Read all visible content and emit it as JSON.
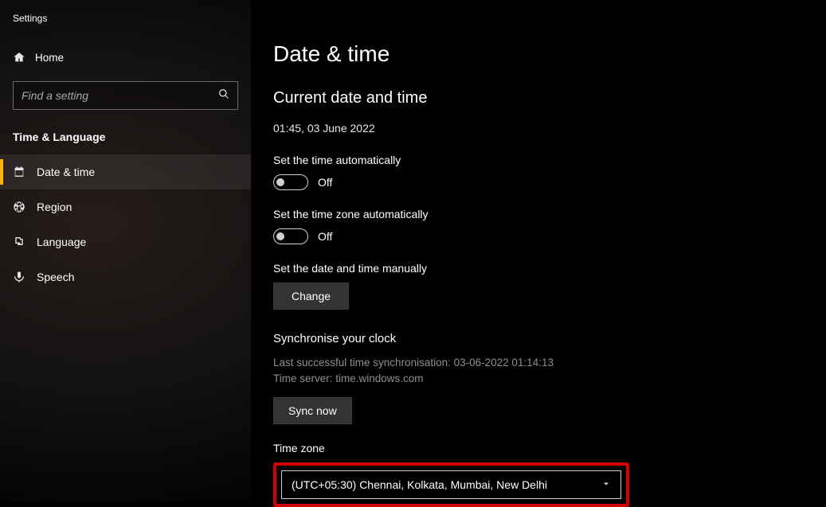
{
  "app_title": "Settings",
  "home_label": "Home",
  "search_placeholder": "Find a setting",
  "category_title": "Time & Language",
  "nav": [
    {
      "label": "Date & time"
    },
    {
      "label": "Region"
    },
    {
      "label": "Language"
    },
    {
      "label": "Speech"
    }
  ],
  "page": {
    "title": "Date & time",
    "current_section": "Current date and time",
    "current_value": "01:45, 03 June 2022",
    "auto_time_label": "Set the time automatically",
    "auto_time_state": "Off",
    "auto_tz_label": "Set the time zone automatically",
    "auto_tz_state": "Off",
    "manual_label": "Set the date and time manually",
    "change_btn": "Change",
    "sync_title": "Synchronise your clock",
    "sync_last": "Last successful time synchronisation: 03-06-2022 01:14:13",
    "sync_server": "Time server: time.windows.com",
    "sync_btn": "Sync now",
    "tz_label": "Time zone",
    "tz_value": "(UTC+05:30) Chennai, Kolkata, Mumbai, New Delhi"
  }
}
